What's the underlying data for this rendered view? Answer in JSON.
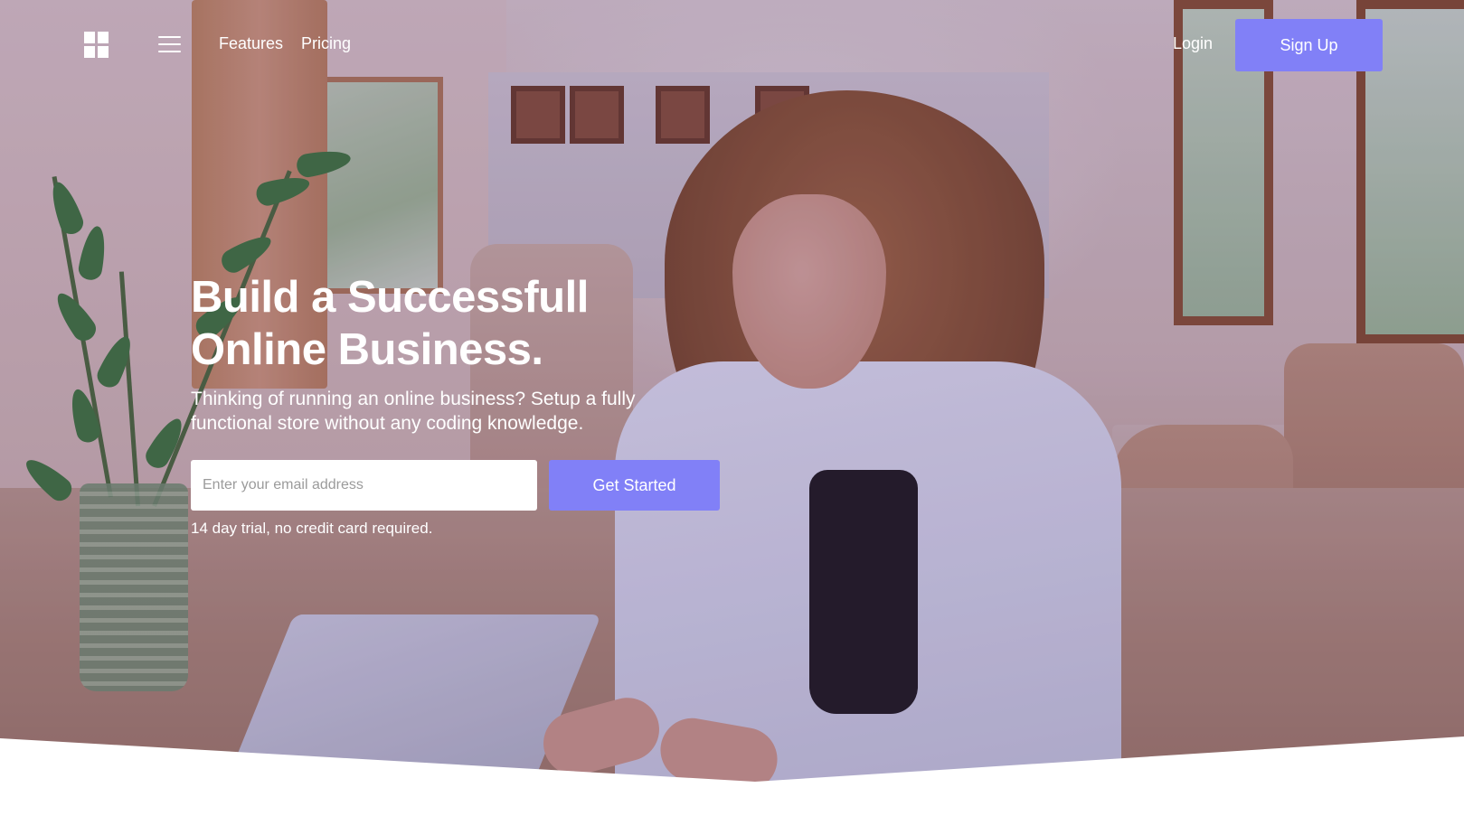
{
  "nav": {
    "logo_icon": "windows-grid-icon",
    "menu_icon": "hamburger-menu-icon",
    "links": [
      {
        "label": "Features"
      },
      {
        "label": "Pricing"
      }
    ],
    "login_label": "Login",
    "signup_label": "Sign Up"
  },
  "hero": {
    "headline_line1": "Build a Successfull",
    "headline_line2": "Online Business.",
    "subtext": "Thinking of running an online business? Setup a fully functional store without any coding knowledge.",
    "email_placeholder": "Enter your email address",
    "email_value": "",
    "cta_label": "Get Started",
    "trial_note": "14 day trial, no credit card required."
  },
  "colors": {
    "accent": "#8180f7",
    "text_light": "#ffffff",
    "overlay_tint": "#8068a0"
  }
}
